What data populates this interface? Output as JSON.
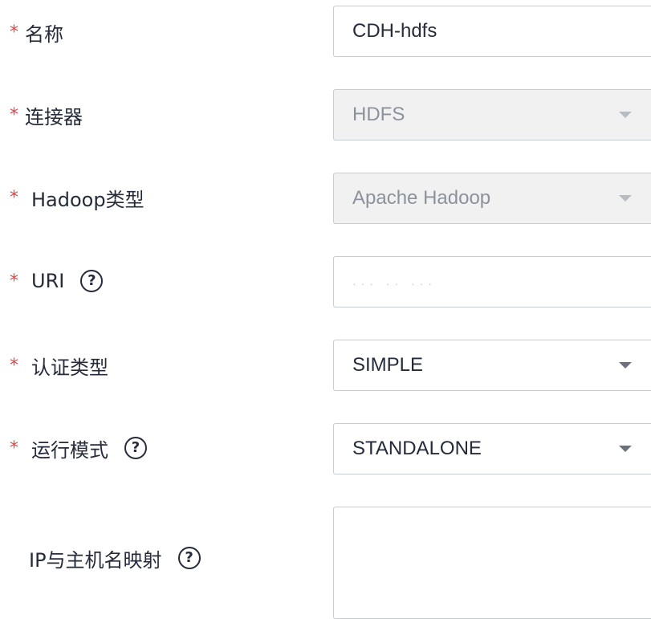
{
  "form": {
    "required_mark": "*",
    "name": {
      "label": "名称",
      "value": "CDH-hdfs"
    },
    "connector": {
      "label": "连接器",
      "value": "HDFS"
    },
    "hadoop_type": {
      "label": "Hadoop类型",
      "value": "Apache Hadoop"
    },
    "uri": {
      "label": "URI",
      "help": "?",
      "value_obscured": "··· ·· ···"
    },
    "auth_type": {
      "label": "认证类型",
      "value": "SIMPLE"
    },
    "run_mode": {
      "label": "运行模式",
      "help": "?",
      "value": "STANDALONE"
    },
    "ip_host_mapping": {
      "label": "IP与主机名映射",
      "help": "?",
      "value": ""
    }
  },
  "colors": {
    "required": "#e54545",
    "text": "#252b3a",
    "disabled_bg": "#f1f1f1",
    "disabled_text": "#8c929c",
    "border": "#c8ccd4"
  }
}
